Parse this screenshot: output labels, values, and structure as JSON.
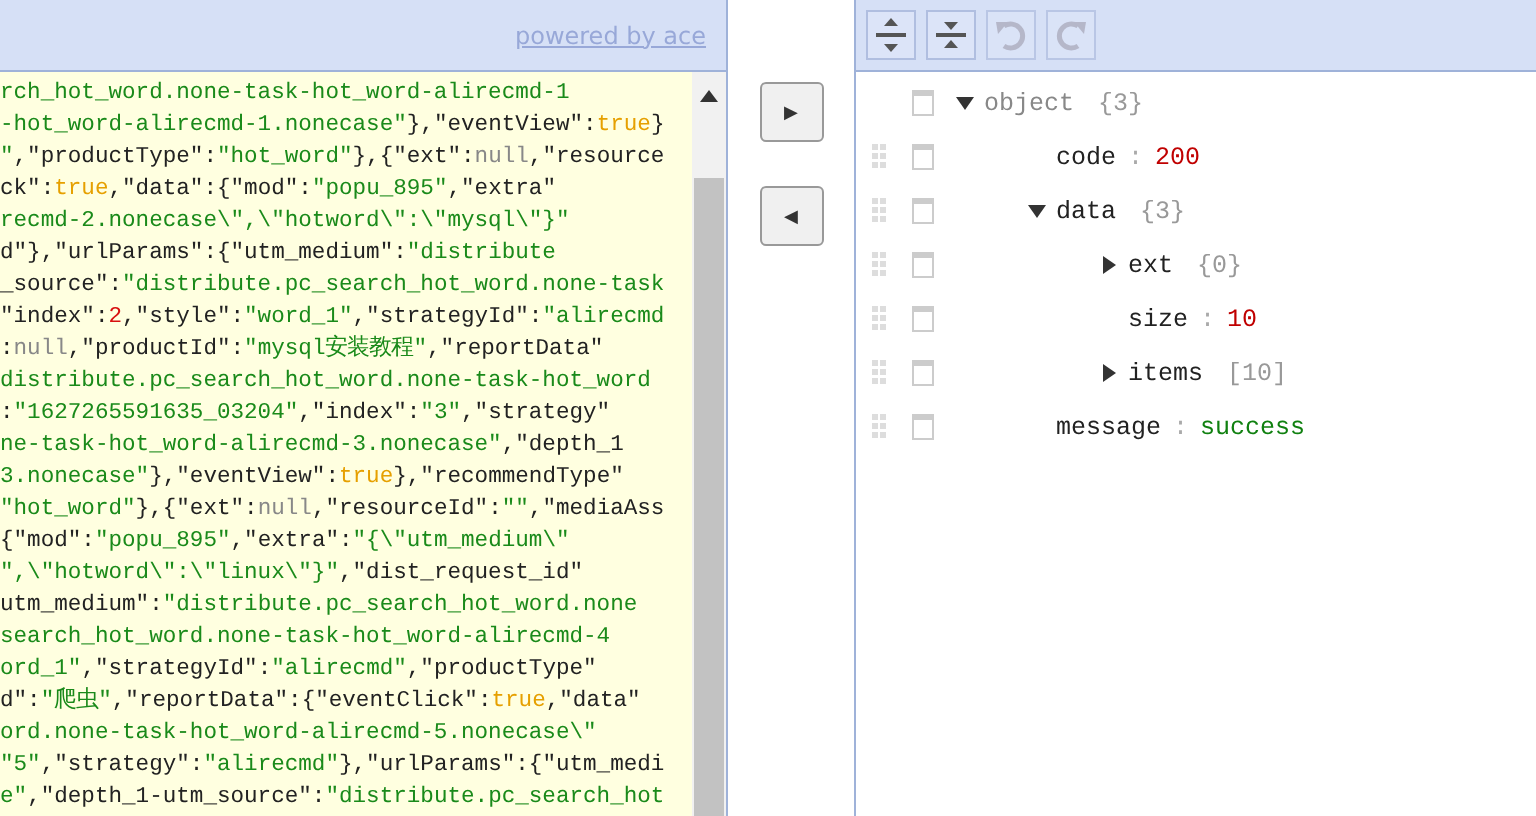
{
  "code_editor": {
    "footer_link": "powered by ace",
    "lines": [
      [
        {
          "kind": "s",
          "text": "rch_hot_word.none-task-hot_word-alirecmd-1"
        }
      ],
      [
        {
          "kind": "s",
          "text": "-hot_word-alirecmd-1.nonecase\""
        },
        {
          "kind": "p",
          "text": "},\"eventView\":"
        },
        {
          "kind": "b",
          "text": "true"
        },
        {
          "kind": "p",
          "text": "}"
        }
      ],
      [
        {
          "kind": "s",
          "text": "\""
        },
        {
          "kind": "p",
          "text": ",\"productType\":"
        },
        {
          "kind": "s",
          "text": "\"hot_word\""
        },
        {
          "kind": "p",
          "text": "},{\"ext\":"
        },
        {
          "kind": "z",
          "text": "null"
        },
        {
          "kind": "p",
          "text": ",\"resource"
        }
      ],
      [
        {
          "kind": "p",
          "text": "ck\":"
        },
        {
          "kind": "b",
          "text": "true"
        },
        {
          "kind": "p",
          "text": ",\"data\":{\"mod\":"
        },
        {
          "kind": "s",
          "text": "\"popu_895\""
        },
        {
          "kind": "p",
          "text": ",\"extra\""
        }
      ],
      [
        {
          "kind": "s",
          "text": "recmd-2.nonecase\\\",\\\"hotword\\\":\\\"mysql\\\"}\""
        }
      ],
      [
        {
          "kind": "p",
          "text": "d\"},\"urlParams\":{\"utm_medium\":"
        },
        {
          "kind": "s",
          "text": "\"distribute"
        }
      ],
      [
        {
          "kind": "p",
          "text": "_source\":"
        },
        {
          "kind": "s",
          "text": "\"distribute.pc_search_hot_word.none-task"
        }
      ],
      [
        {
          "kind": "p",
          "text": "\"index\":"
        },
        {
          "kind": "n",
          "text": "2"
        },
        {
          "kind": "p",
          "text": ",\"style\":"
        },
        {
          "kind": "s",
          "text": "\"word_1\""
        },
        {
          "kind": "p",
          "text": ",\"strategyId\":"
        },
        {
          "kind": "s",
          "text": "\"alirecmd"
        }
      ],
      [
        {
          "kind": "p",
          "text": ":"
        },
        {
          "kind": "z",
          "text": "null"
        },
        {
          "kind": "p",
          "text": ",\"productId\":"
        },
        {
          "kind": "s",
          "text": "\"mysql安装教程\""
        },
        {
          "kind": "p",
          "text": ",\"reportData\""
        }
      ],
      [
        {
          "kind": "s",
          "text": "distribute.pc_search_hot_word.none-task-hot_word"
        }
      ],
      [
        {
          "kind": "p",
          "text": ":"
        },
        {
          "kind": "s",
          "text": "\"1627265591635_03204\""
        },
        {
          "kind": "p",
          "text": ",\"index\":"
        },
        {
          "kind": "s",
          "text": "\"3\""
        },
        {
          "kind": "p",
          "text": ",\"strategy\""
        }
      ],
      [
        {
          "kind": "s",
          "text": "ne-task-hot_word-alirecmd-3.nonecase\""
        },
        {
          "kind": "p",
          "text": ",\"depth_1"
        }
      ],
      [
        {
          "kind": "s",
          "text": "3.nonecase\""
        },
        {
          "kind": "p",
          "text": "},\"eventView\":"
        },
        {
          "kind": "b",
          "text": "true"
        },
        {
          "kind": "p",
          "text": "},\"recommendType\""
        }
      ],
      [
        {
          "kind": "s",
          "text": "\"hot_word\""
        },
        {
          "kind": "p",
          "text": "},{\"ext\":"
        },
        {
          "kind": "z",
          "text": "null"
        },
        {
          "kind": "p",
          "text": ",\"resourceId\":"
        },
        {
          "kind": "s",
          "text": "\"\""
        },
        {
          "kind": "p",
          "text": ",\"mediaAss"
        }
      ],
      [
        {
          "kind": "p",
          "text": "{\"mod\":"
        },
        {
          "kind": "s",
          "text": "\"popu_895\""
        },
        {
          "kind": "p",
          "text": ",\"extra\":"
        },
        {
          "kind": "s",
          "text": "\"{\\\"utm_medium\\\""
        }
      ],
      [
        {
          "kind": "s",
          "text": "\",\\\"hotword\\\":\\\"linux\\\"}\""
        },
        {
          "kind": "p",
          "text": ",\"dist_request_id\""
        }
      ],
      [
        {
          "kind": "p",
          "text": "utm_medium\":"
        },
        {
          "kind": "s",
          "text": "\"distribute.pc_search_hot_word.none"
        }
      ],
      [
        {
          "kind": "s",
          "text": "search_hot_word.none-task-hot_word-alirecmd-4"
        }
      ],
      [
        {
          "kind": "s",
          "text": "ord_1\""
        },
        {
          "kind": "p",
          "text": ",\"strategyId\":"
        },
        {
          "kind": "s",
          "text": "\"alirecmd\""
        },
        {
          "kind": "p",
          "text": ",\"productType\""
        }
      ],
      [
        {
          "kind": "p",
          "text": "d\":"
        },
        {
          "kind": "s",
          "text": "\"爬虫\""
        },
        {
          "kind": "p",
          "text": ",\"reportData\":{\"eventClick\":"
        },
        {
          "kind": "b",
          "text": "true"
        },
        {
          "kind": "p",
          "text": ",\"data\""
        }
      ],
      [
        {
          "kind": "s",
          "text": "ord.none-task-hot_word-alirecmd-5.nonecase\\\""
        }
      ],
      [
        {
          "kind": "s",
          "text": "\"5\""
        },
        {
          "kind": "p",
          "text": ",\"strategy\":"
        },
        {
          "kind": "s",
          "text": "\"alirecmd\""
        },
        {
          "kind": "p",
          "text": "},\"urlParams\":{\"utm_medi"
        }
      ],
      [
        {
          "kind": "s",
          "text": "e\""
        },
        {
          "kind": "p",
          "text": ",\"depth_1-utm_source\":"
        },
        {
          "kind": "s",
          "text": "\"distribute.pc_search_hot"
        }
      ]
    ]
  },
  "transfer_buttons": [
    {
      "glyph": "▶"
    },
    {
      "glyph": "◀"
    }
  ],
  "tree_toolbar": [
    {
      "kind": "expand",
      "disabled": false
    },
    {
      "kind": "collapse",
      "disabled": false
    },
    {
      "kind": "undo",
      "disabled": true
    },
    {
      "kind": "redo",
      "disabled": true
    }
  ],
  "tree": {
    "kind": "object",
    "key": "object",
    "count": "{3}",
    "expanded": true,
    "children": [
      {
        "kind": "value",
        "key": "code",
        "separator": ":",
        "value": "200",
        "color": "#c00000"
      },
      {
        "kind": "object",
        "key": "data",
        "count": "{3}",
        "expanded": true,
        "children": [
          {
            "kind": "object",
            "key": "ext",
            "count": "{0}",
            "expanded": false
          },
          {
            "kind": "value",
            "key": "size",
            "separator": ":",
            "value": "10",
            "color": "#c00000"
          },
          {
            "kind": "object",
            "key": "items",
            "count": "[10]",
            "expanded": false
          }
        ]
      },
      {
        "kind": "value",
        "key": "message",
        "separator": ":",
        "value": "success",
        "color": "#108010"
      }
    ]
  }
}
